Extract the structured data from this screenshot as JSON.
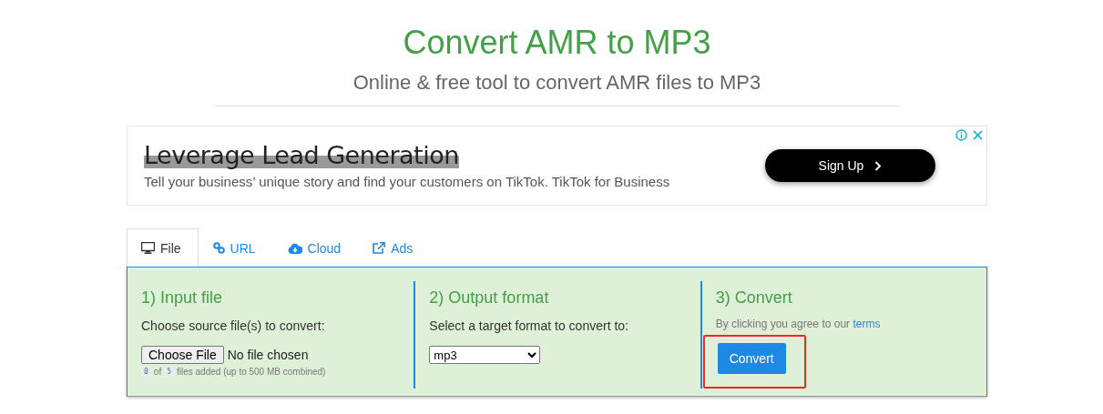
{
  "header": {
    "title": "Convert AMR to MP3",
    "subtitle": "Online & free tool to convert AMR files to MP3"
  },
  "ad": {
    "headline": "Leverage Lead Generation",
    "text": "Tell your business’ unique story and find your customers on TikTok. TikTok for Business",
    "button": "Sign Up"
  },
  "tabs": [
    {
      "label": "File",
      "kind": "monitor",
      "selected": true
    },
    {
      "label": "URL",
      "kind": "link",
      "selected": false
    },
    {
      "label": "Cloud",
      "kind": "cloud",
      "selected": false
    },
    {
      "label": "Ads",
      "kind": "external",
      "selected": false
    }
  ],
  "steps": [
    {
      "title": "1) Input file",
      "kind": "input",
      "label": "Choose source file(s) to convert:",
      "button": "Choose File",
      "status": "No file chosen",
      "count": "0",
      "of": "of",
      "max": "5",
      "note": "files added (up to 500 MB combined)"
    },
    {
      "title": "2) Output format",
      "kind": "format",
      "label": "Select a target format to convert to:",
      "value": "mp3"
    },
    {
      "title": "3) Convert",
      "kind": "convert",
      "label": "By clicking you agree to our",
      "link": "terms",
      "button": "Convert",
      "highlighted": true
    }
  ]
}
